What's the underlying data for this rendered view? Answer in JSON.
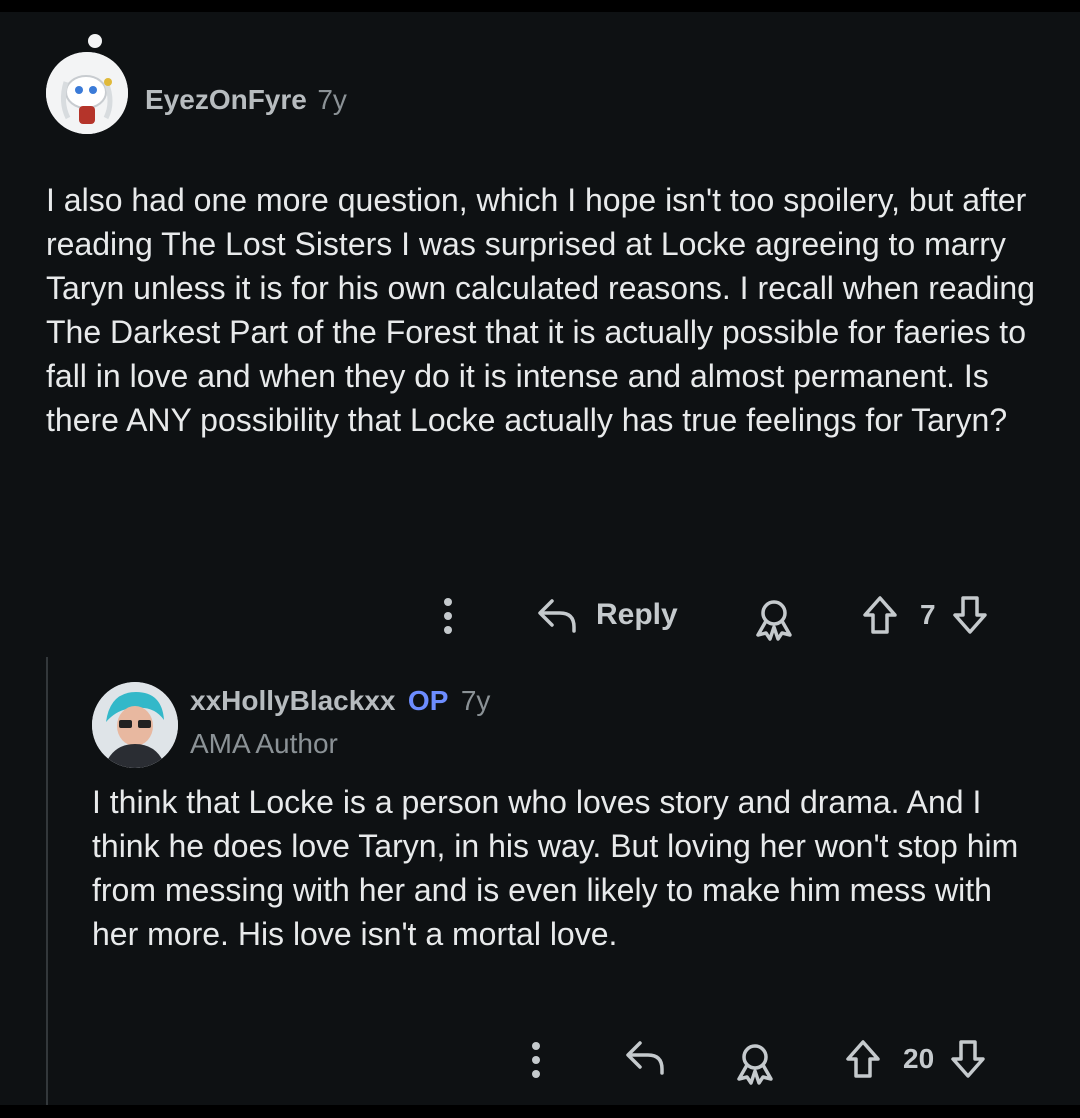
{
  "comment": {
    "username": "EyezOnFyre",
    "age": "7y",
    "body": "I also had one more question, which I hope isn't too spoilery, but after reading The Lost Sisters I was surprised at Locke agreeing to marry Taryn unless it is for his own calculated reasons. I recall when reading The Darkest Part of the Forest that it is actually possible for faeries to fall in love and when they do it is intense and almost permanent. Is there ANY possibility that Locke actually has true feelings for Taryn?",
    "reply_label": "Reply",
    "score": "7"
  },
  "reply": {
    "username": "xxHollyBlackxx",
    "op_badge": "OP",
    "age": "7y",
    "flair": "AMA Author",
    "body": "I think that Locke is a person who loves story and drama. And I think he does love Taryn, in his way. But loving her won't stop him from messing with her and is even likely to make him mess with her more. His love isn't a mortal love.",
    "score": "20"
  },
  "icons": [
    "more-options-icon",
    "reply-arrow-icon",
    "award-icon",
    "upvote-arrow-icon",
    "downvote-arrow-icon"
  ],
  "colors": {
    "background": "#0e1113",
    "text": "#e8eaeb",
    "username": "#b7bcbf",
    "op_badge": "#6d8dff",
    "meta": "#8b9296"
  }
}
